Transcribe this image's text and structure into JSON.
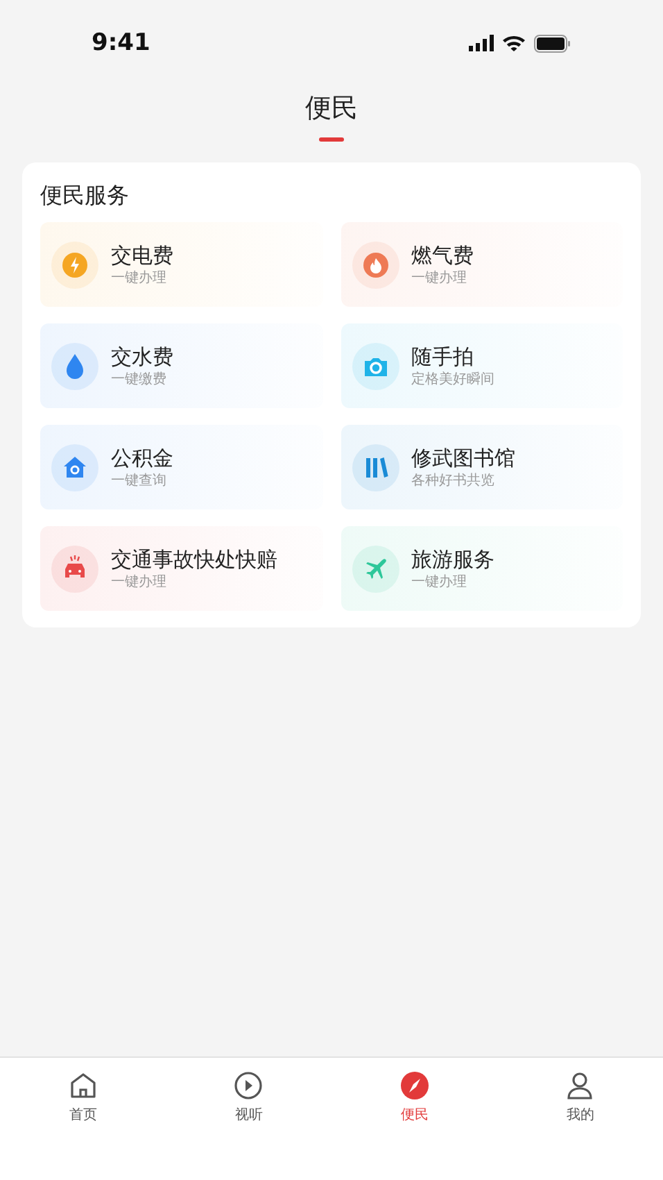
{
  "status_bar": {
    "time": "9:41"
  },
  "header": {
    "tabs": [
      {
        "label": "便民",
        "selected": true
      }
    ]
  },
  "section": {
    "title": "便民服务",
    "services": [
      {
        "kind": "bolt",
        "title": "交电费",
        "subtitle": "一键办理",
        "color": "#f5a623"
      },
      {
        "kind": "flame",
        "title": "燃气费",
        "subtitle": "一键办理",
        "color": "#ee7a55"
      },
      {
        "kind": "drop",
        "title": "交水费",
        "subtitle": "一键缴费",
        "color": "#2f86f0"
      },
      {
        "kind": "camera",
        "title": "随手拍",
        "subtitle": "定格美好瞬间",
        "color": "#1fb3e8"
      },
      {
        "kind": "house",
        "title": "公积金",
        "subtitle": "一键查询",
        "color": "#2f86f0"
      },
      {
        "kind": "books",
        "title": "修武图书馆",
        "subtitle": "各种好书共览",
        "color": "#1a8bd6"
      },
      {
        "kind": "car",
        "title": "交通事故快处快赔",
        "subtitle": "一键办理",
        "color": "#e84a4a"
      },
      {
        "kind": "plane",
        "title": "旅游服务",
        "subtitle": "一键办理",
        "color": "#2dc79a"
      }
    ]
  },
  "bottom_nav": [
    {
      "kind": "home",
      "label": "首页",
      "selected": false
    },
    {
      "kind": "play",
      "label": "视听",
      "selected": false
    },
    {
      "kind": "compass",
      "label": "便民",
      "selected": true
    },
    {
      "kind": "user",
      "label": "我的",
      "selected": false
    }
  ]
}
